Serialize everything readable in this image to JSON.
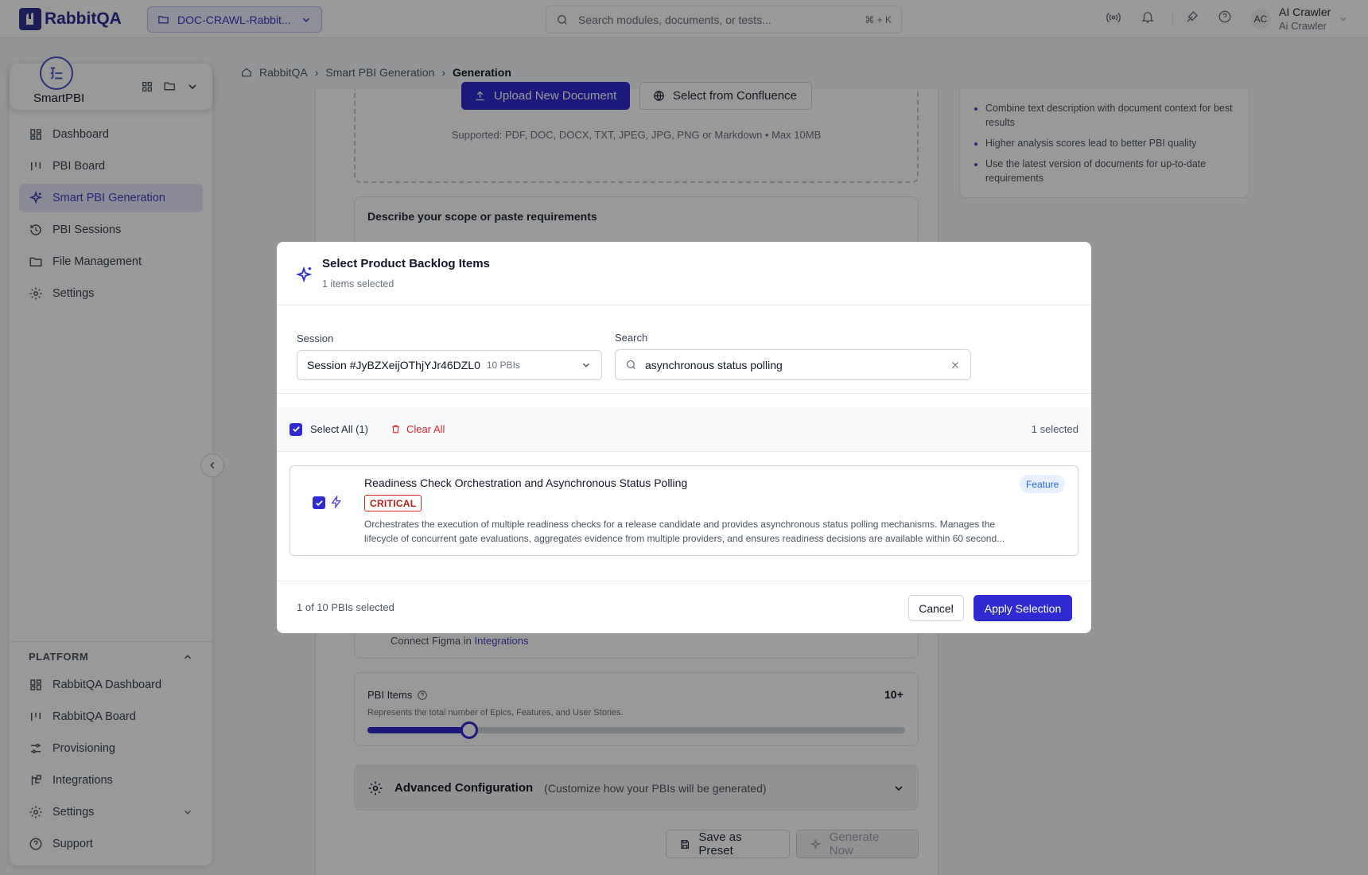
{
  "app": {
    "brand": "RabbitQA",
    "project": "DOC-CRAWL-Rabbit...",
    "search": {
      "placeholder": "Search modules, documents, or tests...",
      "shortcut": "⌘ + K"
    },
    "user": {
      "initials": "AC",
      "name": "AI Crawler",
      "subtitle": "Ai Crawler"
    }
  },
  "sidebar": {
    "module_name": "SmartPBI",
    "items": [
      {
        "label": "Dashboard",
        "icon": "dashboard-icon",
        "active": false
      },
      {
        "label": "PBI Board",
        "icon": "board-icon",
        "active": false
      },
      {
        "label": "Smart PBI Generation",
        "icon": "sparkle-icon",
        "active": true
      },
      {
        "label": "PBI Sessions",
        "icon": "history-icon",
        "active": false
      },
      {
        "label": "File Management",
        "icon": "folder-icon",
        "active": false
      },
      {
        "label": "Settings",
        "icon": "gear-icon",
        "active": false
      }
    ],
    "platform_heading": "PLATFORM",
    "platform_items": [
      {
        "label": "RabbitQA Dashboard",
        "icon": "dashboard-icon"
      },
      {
        "label": "RabbitQA Board",
        "icon": "board-icon"
      },
      {
        "label": "Provisioning",
        "icon": "sliders-icon"
      },
      {
        "label": "Integrations",
        "icon": "integrations-icon"
      },
      {
        "label": "Settings",
        "icon": "gear-icon"
      },
      {
        "label": "Support",
        "icon": "help-icon"
      }
    ]
  },
  "breadcrumb": [
    "RabbitQA",
    "Smart PBI Generation",
    "Generation"
  ],
  "main": {
    "upload_button": "Upload New Document",
    "confluence_button": "Select from Confluence",
    "supported_text": "Supported: PDF, DOC, DOCX, TXT, JPEG, JPG, PNG or Markdown • Max 10MB",
    "describe_label": "Describe your scope or paste requirements",
    "tips": [
      "Combine text description with document context for best results",
      "Higher analysis scores lead to better PBI quality",
      "Use the latest version of documents for up-to-date requirements"
    ],
    "figma_prefix": "Connect Figma in",
    "figma_link": "Integrations",
    "pbi_items_label": "PBI Items",
    "pbi_items_value": "10+",
    "pbi_items_hint": "Represents the total number of Epics, Features, and User Stories.",
    "pbi_slider_fraction": 0.19,
    "advanced_title": "Advanced Configuration",
    "advanced_sub": "(Customize how your PBIs will be generated)",
    "save_preset": "Save as Preset",
    "generate_now": "Generate Now"
  },
  "modal": {
    "title": "Select Product Backlog Items",
    "subtitle": "1 items selected",
    "session_label": "Session",
    "session_value": "Session #JyBZXeijOThjYJr46DZL0",
    "session_count": "10 PBIs",
    "search_label": "Search",
    "search_value": "asynchronous status polling",
    "select_all": "Select All (1)",
    "clear_all": "Clear All",
    "selected_count": "1 selected",
    "item": {
      "title": "Readiness Check Orchestration and Asynchronous Status Polling",
      "priority": "CRITICAL",
      "type": "Feature",
      "desc_line1": "Orchestrates the execution of multiple readiness checks for a release candidate and provides asynchronous status polling mechanisms. Manages the",
      "desc_line2": "lifecycle of concurrent gate evaluations, aggregates evidence from multiple providers, and ensures readiness decisions are available within 60 second...",
      "checked": true
    },
    "footer_text": "1 of 10 PBIs selected",
    "cancel": "Cancel",
    "apply": "Apply Selection"
  },
  "colors": {
    "primary": "#2f2bd0",
    "danger": "#dc2626",
    "active_bg": "#e6e8fb"
  }
}
